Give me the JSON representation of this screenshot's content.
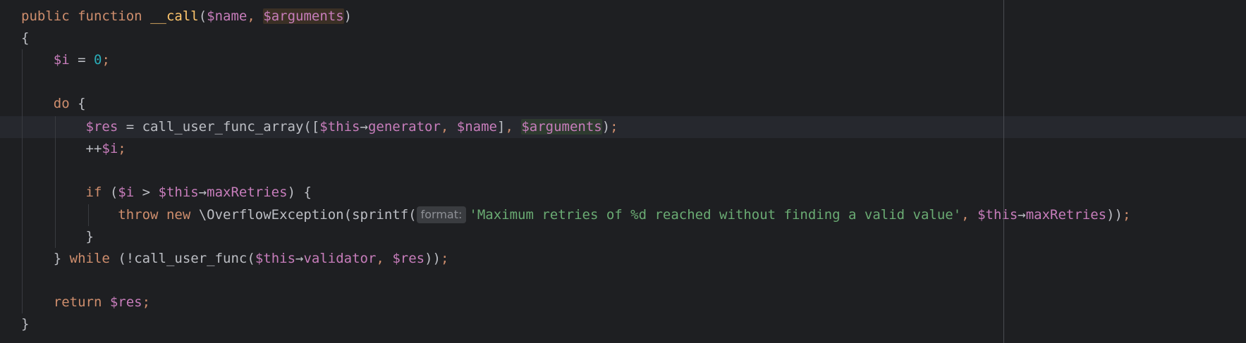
{
  "editor": {
    "lines": [
      {
        "id": "l1",
        "tokens": [
          {
            "t": "public",
            "c": "kw"
          },
          {
            "t": " ",
            "c": "punc"
          },
          {
            "t": "function",
            "c": "kw"
          },
          {
            "t": " ",
            "c": "punc"
          },
          {
            "t": "__call",
            "c": "fn-def"
          },
          {
            "t": "(",
            "c": "punc"
          },
          {
            "t": "$name",
            "c": "var"
          },
          {
            "t": ", ",
            "c": "semi"
          },
          {
            "t": "$arguments",
            "c": "var hl-arg"
          },
          {
            "t": ")",
            "c": "punc"
          }
        ]
      },
      {
        "id": "l2",
        "tokens": [
          {
            "t": "{",
            "c": "punc"
          }
        ]
      },
      {
        "id": "l3",
        "tokens": [
          {
            "t": "    ",
            "c": "punc"
          },
          {
            "t": "$i",
            "c": "var"
          },
          {
            "t": " = ",
            "c": "punc"
          },
          {
            "t": "0",
            "c": "num"
          },
          {
            "t": ";",
            "c": "semi"
          }
        ]
      },
      {
        "id": "l4",
        "tokens": []
      },
      {
        "id": "l5",
        "tokens": [
          {
            "t": "    ",
            "c": "punc"
          },
          {
            "t": "do",
            "c": "kw"
          },
          {
            "t": " {",
            "c": "punc"
          }
        ]
      },
      {
        "id": "l6",
        "tokens": [
          {
            "t": "        ",
            "c": "punc"
          },
          {
            "t": "$res",
            "c": "var"
          },
          {
            "t": " = ",
            "c": "punc"
          },
          {
            "t": "call_user_func_array",
            "c": "punc"
          },
          {
            "t": "([",
            "c": "punc"
          },
          {
            "t": "$this",
            "c": "var"
          },
          {
            "t": "→",
            "c": "punc"
          },
          {
            "t": "generator",
            "c": "prop"
          },
          {
            "t": ", ",
            "c": "semi"
          },
          {
            "t": "$name",
            "c": "var"
          },
          {
            "t": "]",
            "c": "punc"
          },
          {
            "t": ", ",
            "c": "semi"
          },
          {
            "t": "$arguments",
            "c": "var hl-arg2"
          },
          {
            "t": ")",
            "c": "punc"
          },
          {
            "t": ";",
            "c": "semi"
          }
        ]
      },
      {
        "id": "l7",
        "tokens": [
          {
            "t": "        ",
            "c": "punc"
          },
          {
            "t": "++",
            "c": "punc"
          },
          {
            "t": "$i",
            "c": "var"
          },
          {
            "t": ";",
            "c": "semi"
          }
        ]
      },
      {
        "id": "l8",
        "tokens": []
      },
      {
        "id": "l9",
        "tokens": [
          {
            "t": "        ",
            "c": "punc"
          },
          {
            "t": "if",
            "c": "kw"
          },
          {
            "t": " (",
            "c": "punc"
          },
          {
            "t": "$i",
            "c": "var"
          },
          {
            "t": " > ",
            "c": "punc"
          },
          {
            "t": "$this",
            "c": "var"
          },
          {
            "t": "→",
            "c": "punc"
          },
          {
            "t": "maxRetries",
            "c": "prop"
          },
          {
            "t": ") {",
            "c": "punc"
          }
        ]
      },
      {
        "id": "l10",
        "tokens": [
          {
            "t": "            ",
            "c": "punc"
          },
          {
            "t": "throw",
            "c": "kw"
          },
          {
            "t": " ",
            "c": "punc"
          },
          {
            "t": "new",
            "c": "kw"
          },
          {
            "t": " ",
            "c": "punc"
          },
          {
            "t": "\\OverflowException",
            "c": "punc"
          },
          {
            "t": "(",
            "c": "punc"
          },
          {
            "t": "sprintf",
            "c": "punc"
          },
          {
            "t": "(",
            "c": "punc"
          },
          {
            "t": "format:",
            "c": "hint"
          },
          {
            "t": "'Maximum retries of %d reached without finding a valid value'",
            "c": "str"
          },
          {
            "t": ", ",
            "c": "semi"
          },
          {
            "t": "$this",
            "c": "var"
          },
          {
            "t": "→",
            "c": "punc"
          },
          {
            "t": "maxRetries",
            "c": "prop"
          },
          {
            "t": "))",
            "c": "punc"
          },
          {
            "t": ";",
            "c": "semi"
          }
        ]
      },
      {
        "id": "l11",
        "tokens": [
          {
            "t": "        ",
            "c": "punc"
          },
          {
            "t": "}",
            "c": "punc"
          }
        ]
      },
      {
        "id": "l12",
        "tokens": [
          {
            "t": "    ",
            "c": "punc"
          },
          {
            "t": "}",
            "c": "punc"
          },
          {
            "t": " ",
            "c": "punc"
          },
          {
            "t": "while",
            "c": "kw"
          },
          {
            "t": " (!",
            "c": "punc"
          },
          {
            "t": "call_user_func",
            "c": "punc"
          },
          {
            "t": "(",
            "c": "punc"
          },
          {
            "t": "$this",
            "c": "var"
          },
          {
            "t": "→",
            "c": "punc"
          },
          {
            "t": "validator",
            "c": "prop"
          },
          {
            "t": ", ",
            "c": "semi"
          },
          {
            "t": "$res",
            "c": "var"
          },
          {
            "t": "))",
            "c": "punc"
          },
          {
            "t": ";",
            "c": "semi"
          }
        ]
      },
      {
        "id": "l13",
        "tokens": []
      },
      {
        "id": "l14",
        "tokens": [
          {
            "t": "    ",
            "c": "punc"
          },
          {
            "t": "return",
            "c": "kw"
          },
          {
            "t": " ",
            "c": "punc"
          },
          {
            "t": "$res",
            "c": "var"
          },
          {
            "t": ";",
            "c": "semi"
          }
        ]
      },
      {
        "id": "l15",
        "tokens": [
          {
            "t": "}",
            "c": "punc"
          }
        ]
      }
    ],
    "current_line": "l6"
  },
  "colors": {
    "background": "#1e1f22",
    "current_line": "#26282e",
    "keyword": "#cf8e6d",
    "variable": "#c77dbb",
    "string": "#6aab73",
    "number": "#2aacb8",
    "function_def": "#ffc66d"
  }
}
